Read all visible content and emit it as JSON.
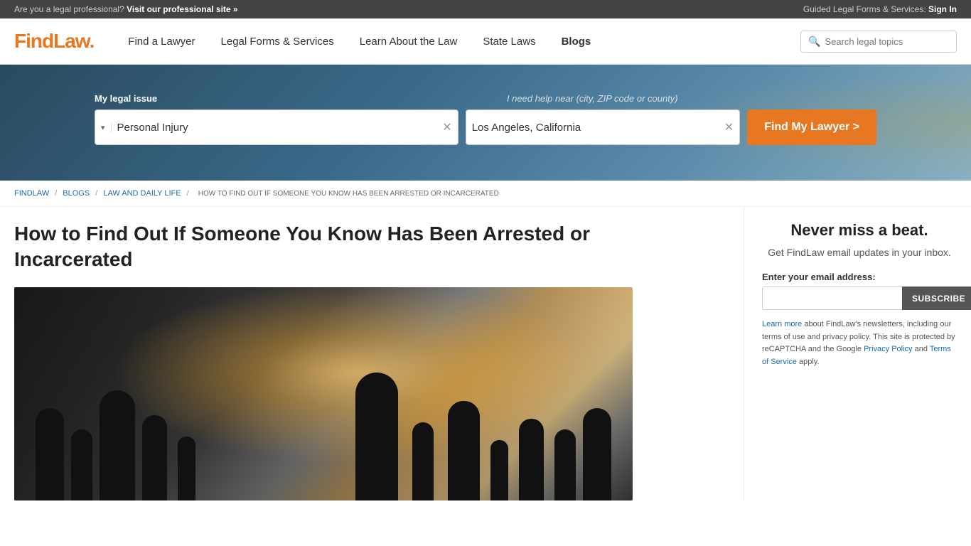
{
  "topbar": {
    "left_text": "Are you a legal professional?",
    "left_link": "Visit our professional site »",
    "right_text": "Guided Legal Forms & Services:",
    "right_link": "Sign In"
  },
  "header": {
    "logo": "FindLaw.",
    "nav": [
      {
        "id": "find-lawyer",
        "label": "Find a Lawyer",
        "active": false
      },
      {
        "id": "legal-forms",
        "label": "Legal Forms & Services",
        "active": false
      },
      {
        "id": "learn-law",
        "label": "Learn About the Law",
        "active": false
      },
      {
        "id": "state-laws",
        "label": "State Laws",
        "active": false
      },
      {
        "id": "blogs",
        "label": "Blogs",
        "active": true
      }
    ],
    "search_placeholder": "Search legal topics"
  },
  "hero": {
    "label_issue": "My legal issue",
    "label_near": "I need help near",
    "label_near_sub": "(city, ZIP code or county)",
    "issue_value": "Personal Injury",
    "near_value": "Los Angeles, California",
    "button_label": "Find My Lawyer >"
  },
  "breadcrumb": {
    "items": [
      {
        "label": "FINDLAW",
        "href": true
      },
      {
        "label": "BLOGS",
        "href": true
      },
      {
        "label": "LAW AND DAILY LIFE",
        "href": true
      }
    ],
    "current": "HOW TO FIND OUT IF SOMEONE YOU KNOW HAS BEEN ARRESTED OR INCARCERATED"
  },
  "article": {
    "title": "How to Find Out If Someone You Know Has Been Arrested or Incarcerated"
  },
  "sidebar": {
    "newsletter_title": "Never miss a beat.",
    "newsletter_sub": "Get FindLaw email updates in your inbox.",
    "email_label": "Enter your email address:",
    "email_placeholder": "",
    "subscribe_label": "SUBSCRIBE",
    "fine_print_1": "Learn more",
    "fine_print_2": " about FindLaw's newsletters, including our terms of use and privacy policy. This site is protected by reCAPTCHA and the Google ",
    "fine_print_3": "Privacy Policy",
    "fine_print_4": " and ",
    "fine_print_5": "Terms of Service",
    "fine_print_6": " apply."
  }
}
